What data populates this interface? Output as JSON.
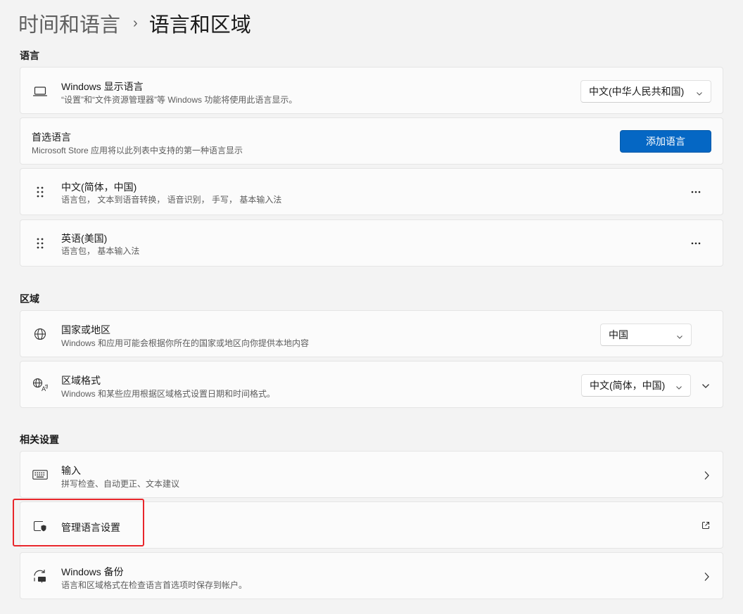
{
  "breadcrumb": {
    "parent": "时间和语言",
    "separator": "›",
    "current": "语言和区域"
  },
  "sections": {
    "language": "语言",
    "region": "区域",
    "related": "相关设置"
  },
  "display_language": {
    "icon": "laptop-icon",
    "title": "Windows 显示语言",
    "subtitle": "“设置”和“文件资源管理器”等 Windows 功能将使用此语言显示。",
    "selected": "中文(中华人民共和国)"
  },
  "preferred_languages": {
    "title": "首选语言",
    "subtitle": "Microsoft Store 应用将以此列表中支持的第一种语言显示",
    "add_button": "添加语言",
    "items": [
      {
        "name": "中文(简体，中国)",
        "features": "语言包， 文本到语音转换， 语音识别， 手写， 基本输入法"
      },
      {
        "name": "英语(美国)",
        "features": "语言包， 基本输入法"
      }
    ]
  },
  "country": {
    "icon": "globe-icon",
    "title": "国家或地区",
    "subtitle": "Windows 和应用可能会根据你所在的国家或地区向你提供本地内容",
    "selected": "中国"
  },
  "regional_format": {
    "icon": "regional-format-icon",
    "title": "区域格式",
    "subtitle": "Windows 和某些应用根据区域格式设置日期和时间格式。",
    "selected": "中文(简体，中国)"
  },
  "related": {
    "typing": {
      "icon": "keyboard-icon",
      "title": "输入",
      "subtitle": "拼写检查、自动更正、文本建议"
    },
    "admin": {
      "icon": "shield-window-icon",
      "title": "管理语言设置"
    },
    "backup": {
      "icon": "backup-sync-icon",
      "title": "Windows 备份",
      "subtitle": "语言和区域格式在检查语言首选项时保存到帐户。"
    }
  },
  "colors": {
    "accent": "#0567c4",
    "highlight": "#e8262b",
    "background": "#f3f3f3",
    "card": "#fbfbfb"
  }
}
